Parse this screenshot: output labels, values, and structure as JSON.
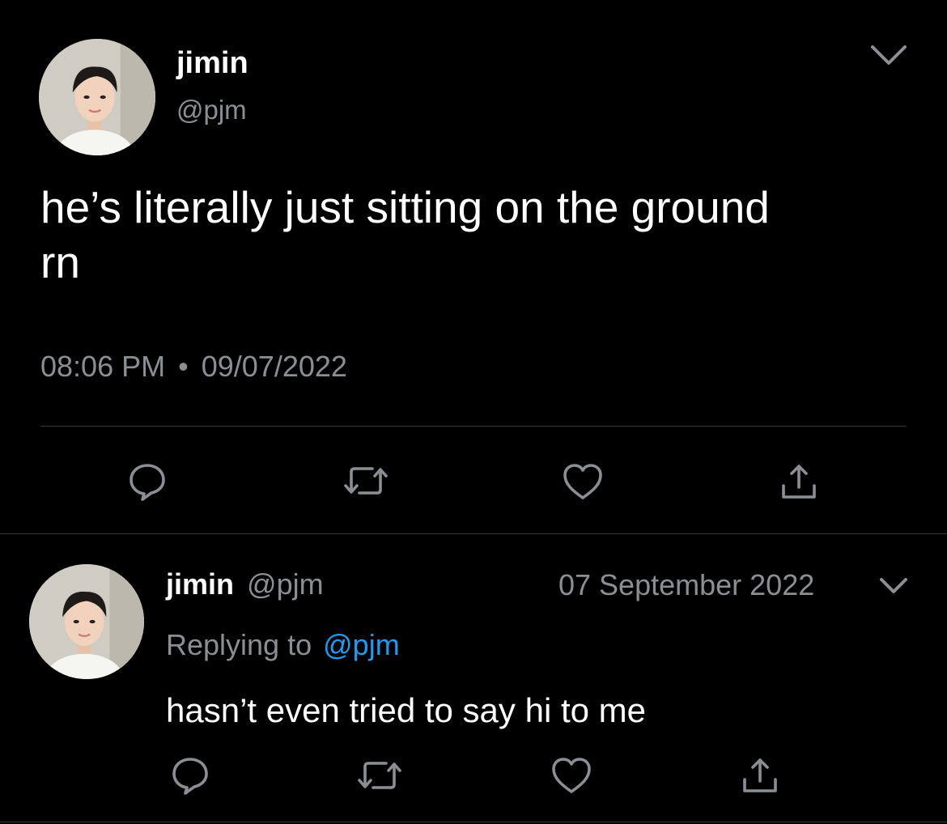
{
  "main_tweet": {
    "display_name": "jimin",
    "handle": "@pjm",
    "text_line1": "he’s literally just sitting on the ground",
    "text_line2": "rn",
    "time": "08:06 PM",
    "separator": "•",
    "date": "09/07/2022",
    "avatar_icon": "profile-photo",
    "menu_icon": "chevron-down-icon"
  },
  "reply_tweet": {
    "display_name": "jimin",
    "handle": "@pjm",
    "date": "07 September 2022",
    "replying_prefix": "Replying to",
    "replying_handle": "@pjm",
    "text": "hasn’t even tried to say hi to me",
    "avatar_icon": "profile-photo",
    "menu_icon": "chevron-down-icon"
  },
  "actions": [
    "reply-icon",
    "retweet-icon",
    "like-icon",
    "share-icon"
  ],
  "colors": {
    "background": "#000000",
    "text": "#ffffff",
    "muted": "#8b8f94",
    "link": "#1d9bf0",
    "divider": "#38393c"
  }
}
